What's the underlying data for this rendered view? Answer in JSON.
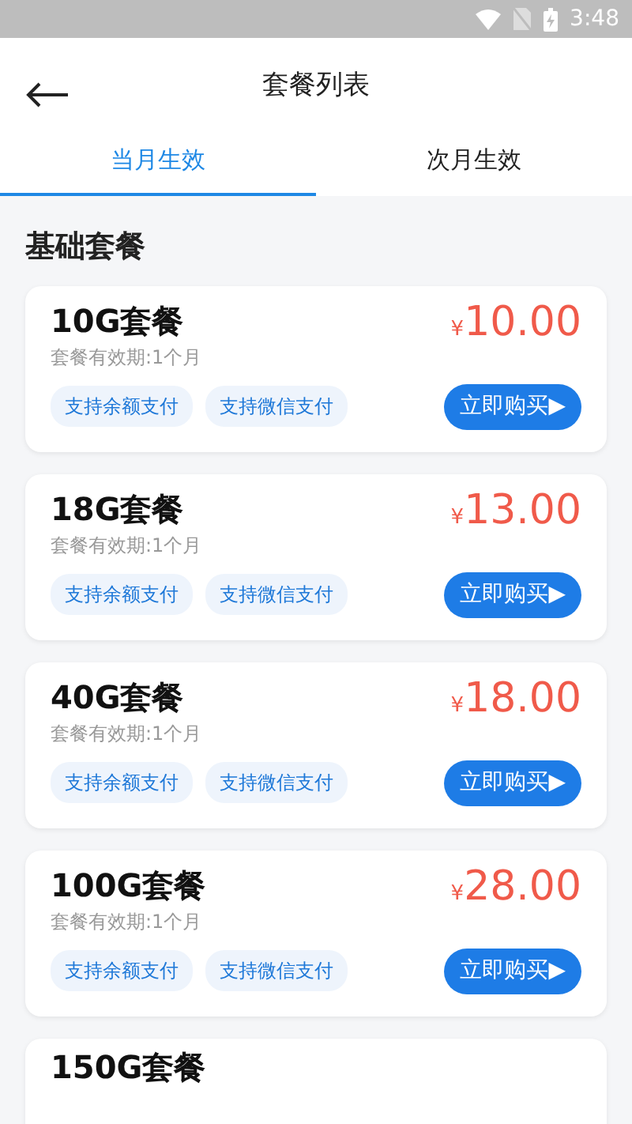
{
  "status_bar": {
    "time": "3:48"
  },
  "header": {
    "title": "套餐列表"
  },
  "tabs": [
    {
      "label": "当月生效",
      "selected": true
    },
    {
      "label": "次月生效",
      "selected": false
    }
  ],
  "section": {
    "title": "基础套餐"
  },
  "packages": [
    {
      "name": "10G套餐",
      "currency": "¥",
      "price": "10.00",
      "validity": "套餐有效期:1个月",
      "tags": [
        "支持余额支付",
        "支持微信支付"
      ],
      "button": "立即购买▶"
    },
    {
      "name": "18G套餐",
      "currency": "¥",
      "price": "13.00",
      "validity": "套餐有效期:1个月",
      "tags": [
        "支持余额支付",
        "支持微信支付"
      ],
      "button": "立即购买▶"
    },
    {
      "name": "40G套餐",
      "currency": "¥",
      "price": "18.00",
      "validity": "套餐有效期:1个月",
      "tags": [
        "支持余额支付",
        "支持微信支付"
      ],
      "button": "立即购买▶"
    },
    {
      "name": "100G套餐",
      "currency": "¥",
      "price": "28.00",
      "validity": "套餐有效期:1个月",
      "tags": [
        "支持余额支付",
        "支持微信支付"
      ],
      "button": "立即购买▶"
    },
    {
      "name": "150G套餐"
    }
  ]
}
